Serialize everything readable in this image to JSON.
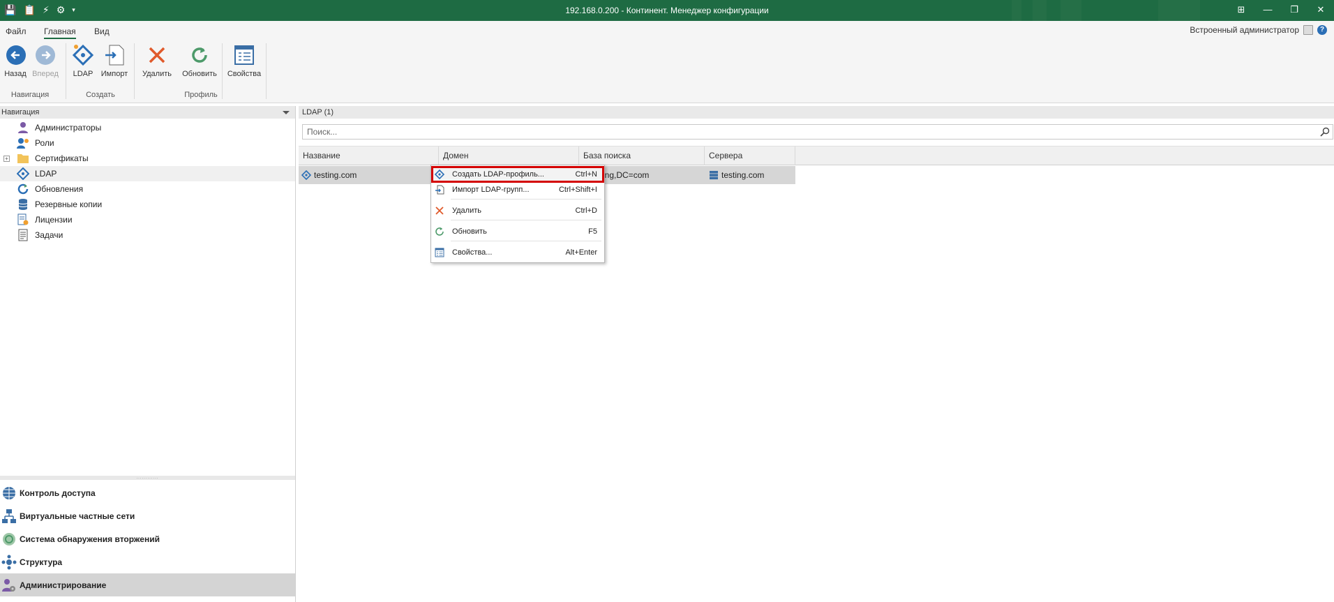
{
  "window": {
    "title": "192.168.0.200 - Континент. Менеджер конфигурации",
    "buttons": [
      "restore-down",
      "minimize",
      "maximize",
      "close"
    ]
  },
  "menu": {
    "tabs": [
      "Файл",
      "Главная",
      "Вид"
    ],
    "active_tab": "Главная",
    "user": "Встроенный администратор",
    "help": "?"
  },
  "ribbon": {
    "buttons": {
      "back": "Назад",
      "forward": "Вперед",
      "ldap": "LDAP",
      "import": "Импорт",
      "delete": "Удалить",
      "refresh": "Обновить",
      "properties": "Свойства"
    },
    "groups": {
      "navigation": "Навигация",
      "create": "Создать",
      "profile": "Профиль"
    }
  },
  "nav": {
    "header": "Навигация",
    "items": [
      {
        "label": "Администраторы",
        "icon": "admin-icon"
      },
      {
        "label": "Роли",
        "icon": "roles-icon"
      },
      {
        "label": "Сертификаты",
        "icon": "folder-icon",
        "expandable": true
      },
      {
        "label": "LDAP",
        "icon": "ldap-icon",
        "selected": true
      },
      {
        "label": "Обновления",
        "icon": "updates-icon"
      },
      {
        "label": "Резервные копии",
        "icon": "database-icon"
      },
      {
        "label": "Лицензии",
        "icon": "license-icon"
      },
      {
        "label": "Задачи",
        "icon": "tasks-icon"
      }
    ],
    "sections": [
      {
        "label": "Контроль доступа",
        "icon": "globe-icon"
      },
      {
        "label": "Виртуальные частные сети",
        "icon": "network-icon"
      },
      {
        "label": "Система обнаружения вторжений",
        "icon": "ids-icon"
      },
      {
        "label": "Структура",
        "icon": "structure-icon"
      },
      {
        "label": "Администрирование",
        "icon": "admin-gear-icon",
        "selected": true
      }
    ]
  },
  "main": {
    "header": "LDAP (1)",
    "search_placeholder": "Поиск...",
    "columns": [
      "Название",
      "Домен",
      "База поиска",
      "Сервера"
    ],
    "rows": [
      {
        "name": "testing.com",
        "domain": "",
        "search_base": "ing,DC=com",
        "servers": "testing.com"
      }
    ]
  },
  "context_menu": {
    "items": [
      {
        "label": "Создать LDAP-профиль...",
        "shortcut": "Ctrl+N",
        "icon": "ldap-icon",
        "highlighted": true
      },
      {
        "label": "Импорт LDAP-групп...",
        "shortcut": "Ctrl+Shift+I",
        "icon": "import-icon"
      },
      {
        "label": "Удалить",
        "shortcut": "Ctrl+D",
        "icon": "delete-icon"
      },
      {
        "label": "Обновить",
        "shortcut": "F5",
        "icon": "refresh-icon"
      },
      {
        "label": "Свойства...",
        "shortcut": "Alt+Enter",
        "icon": "properties-icon"
      }
    ]
  },
  "colors": {
    "titlebar": "#1e6b43",
    "highlight_border": "#d40000",
    "accent_blue": "#2b6fb6",
    "delete_red": "#e05a2b",
    "refresh_green": "#4d9a6a"
  }
}
